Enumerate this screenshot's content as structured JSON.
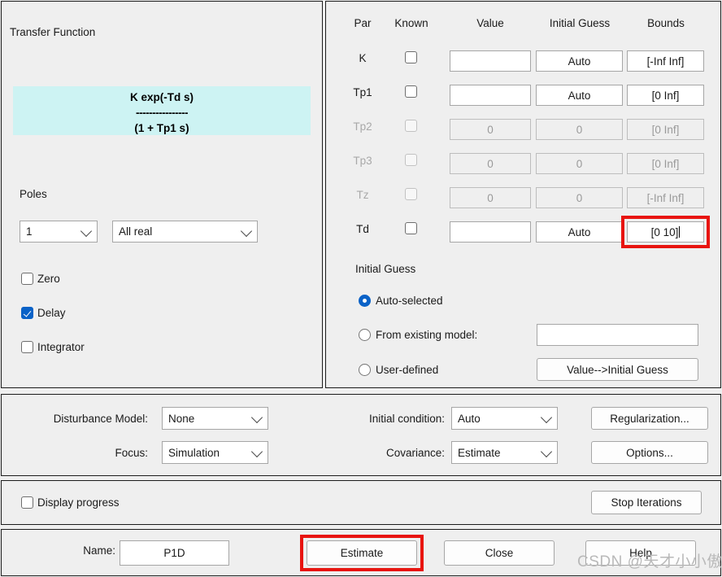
{
  "model": {
    "section_title": "Transfer Function",
    "transfer_function": {
      "numerator": "K exp(-Td s)",
      "bar": "----------------",
      "denominator": "(1 + Tp1 s)"
    },
    "poles_label": "Poles",
    "poles_count": "1",
    "poles_type": "All real",
    "checkboxes": [
      {
        "label": "Zero",
        "checked": false
      },
      {
        "label": "Delay",
        "checked": true
      },
      {
        "label": "Integrator",
        "checked": false
      }
    ]
  },
  "params": {
    "headers": [
      "Par",
      "Known",
      "Value",
      "Initial Guess",
      "Bounds"
    ],
    "rows": [
      {
        "name": "K",
        "known": false,
        "value": "",
        "guess": "Auto",
        "bounds": "[-Inf Inf]",
        "enabled": true,
        "highlight": false
      },
      {
        "name": "Tp1",
        "known": false,
        "value": "",
        "guess": "Auto",
        "bounds": "[0 Inf]",
        "enabled": true,
        "highlight": false
      },
      {
        "name": "Tp2",
        "known": false,
        "value": "0",
        "guess": "0",
        "bounds": "[0 Inf]",
        "enabled": false,
        "highlight": false
      },
      {
        "name": "Tp3",
        "known": false,
        "value": "0",
        "guess": "0",
        "bounds": "[0 Inf]",
        "enabled": false,
        "highlight": false
      },
      {
        "name": "Tz",
        "known": false,
        "value": "0",
        "guess": "0",
        "bounds": "[-Inf Inf]",
        "enabled": false,
        "highlight": false
      },
      {
        "name": "Td",
        "known": false,
        "value": "",
        "guess": "Auto",
        "bounds": "[0 10]",
        "enabled": true,
        "highlight": true
      }
    ]
  },
  "initial_guess": {
    "section_title": "Initial Guess",
    "options": [
      {
        "label": "Auto-selected",
        "selected": true
      },
      {
        "label": "From existing model:",
        "selected": false
      },
      {
        "label": "User-defined",
        "selected": false
      }
    ],
    "existing_model_value": "",
    "value_to_guess_button": "Value-->Initial Guess"
  },
  "options": {
    "disturbance_model_label": "Disturbance Model:",
    "disturbance_model_value": "None",
    "focus_label": "Focus:",
    "focus_value": "Simulation",
    "initial_condition_label": "Initial condition:",
    "initial_condition_value": "Auto",
    "covariance_label": "Covariance:",
    "covariance_value": "Estimate",
    "regularization_button": "Regularization...",
    "options_button": "Options..."
  },
  "progress": {
    "display_progress_label": "Display progress",
    "display_progress_checked": false,
    "stop_iterations_button": "Stop Iterations"
  },
  "actions": {
    "name_label": "Name:",
    "name_value": "P1D",
    "estimate_button": "Estimate",
    "close_button": "Close",
    "help_button": "Help"
  },
  "watermark": {
    "text": "CSDN @天才小小傲"
  },
  "colors": {
    "accent": "#0a62c7",
    "highlight_ring": "#e8140f",
    "tf_background": "#cdf3f3",
    "panel_background": "#efefef"
  }
}
